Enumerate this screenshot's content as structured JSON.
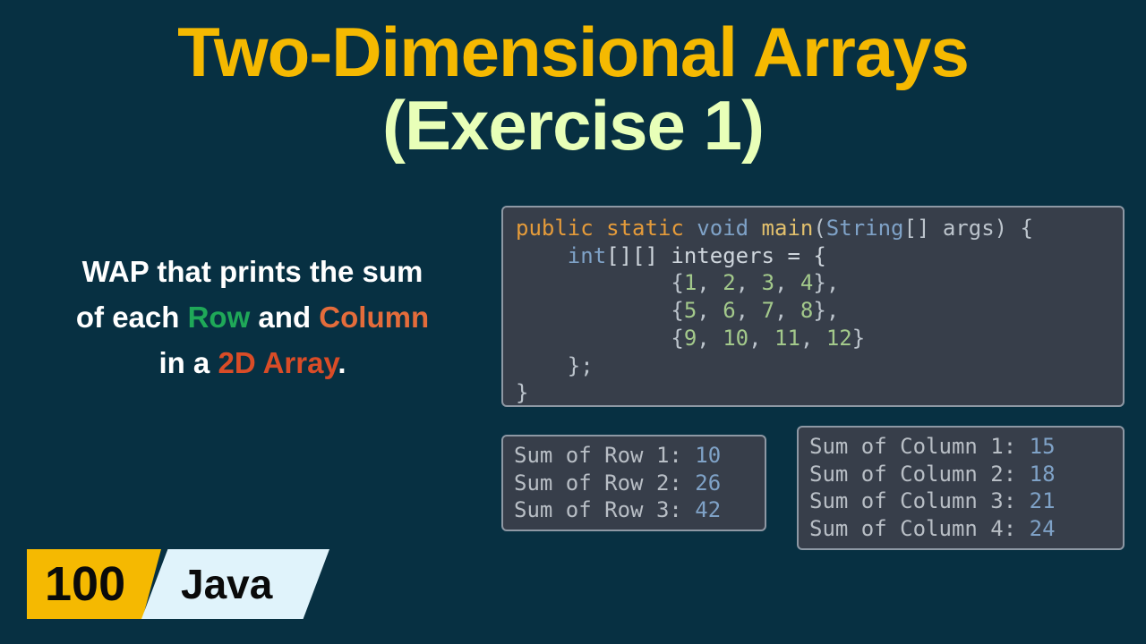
{
  "title": {
    "line1": "Two-Dimensional Arrays",
    "line2": "(Exercise 1)"
  },
  "prompt": {
    "p1": "WAP that prints the sum",
    "p2a": "of each ",
    "row": "Row",
    "p2b": " and ",
    "col": "Column",
    "p3a": "in a ",
    "arr": "2D Array",
    "p3b": "."
  },
  "code": {
    "l1a": "public static ",
    "l1b": "void ",
    "l1c": "main",
    "l1d": "(",
    "l1e": "String",
    "l1f": "[] args) {",
    "l2a": "    int",
    "l2b": "[][] integers = {",
    "l3a": "            {",
    "l3b": "1",
    "l3c": ", ",
    "l3d": "2",
    "l3e": ", ",
    "l3f": "3",
    "l3g": ", ",
    "l3h": "4",
    "l3i": "},",
    "l4a": "            {",
    "l4b": "5",
    "l4c": ", ",
    "l4d": "6",
    "l4e": ", ",
    "l4f": "7",
    "l4g": ", ",
    "l4h": "8",
    "l4i": "},",
    "l5a": "            {",
    "l5b": "9",
    "l5c": ", ",
    "l5d": "10",
    "l5e": ", ",
    "l5f": "11",
    "l5g": ", ",
    "l5h": "12",
    "l5i": "}",
    "l6": "    };",
    "l7": "}"
  },
  "rows": {
    "r1l": "Sum of Row 1: ",
    "r1v": "10",
    "r2l": "Sum of Row 2: ",
    "r2v": "26",
    "r3l": "Sum of Row 3: ",
    "r3v": "42"
  },
  "cols": {
    "c1l": "Sum of Column 1: ",
    "c1v": "15",
    "c2l": "Sum of Column 2: ",
    "c2v": "18",
    "c3l": "Sum of Column 3: ",
    "c3v": "21",
    "c4l": "Sum of Column 4: ",
    "c4v": "24"
  },
  "badge": {
    "num": "100",
    "lang": "Java"
  }
}
